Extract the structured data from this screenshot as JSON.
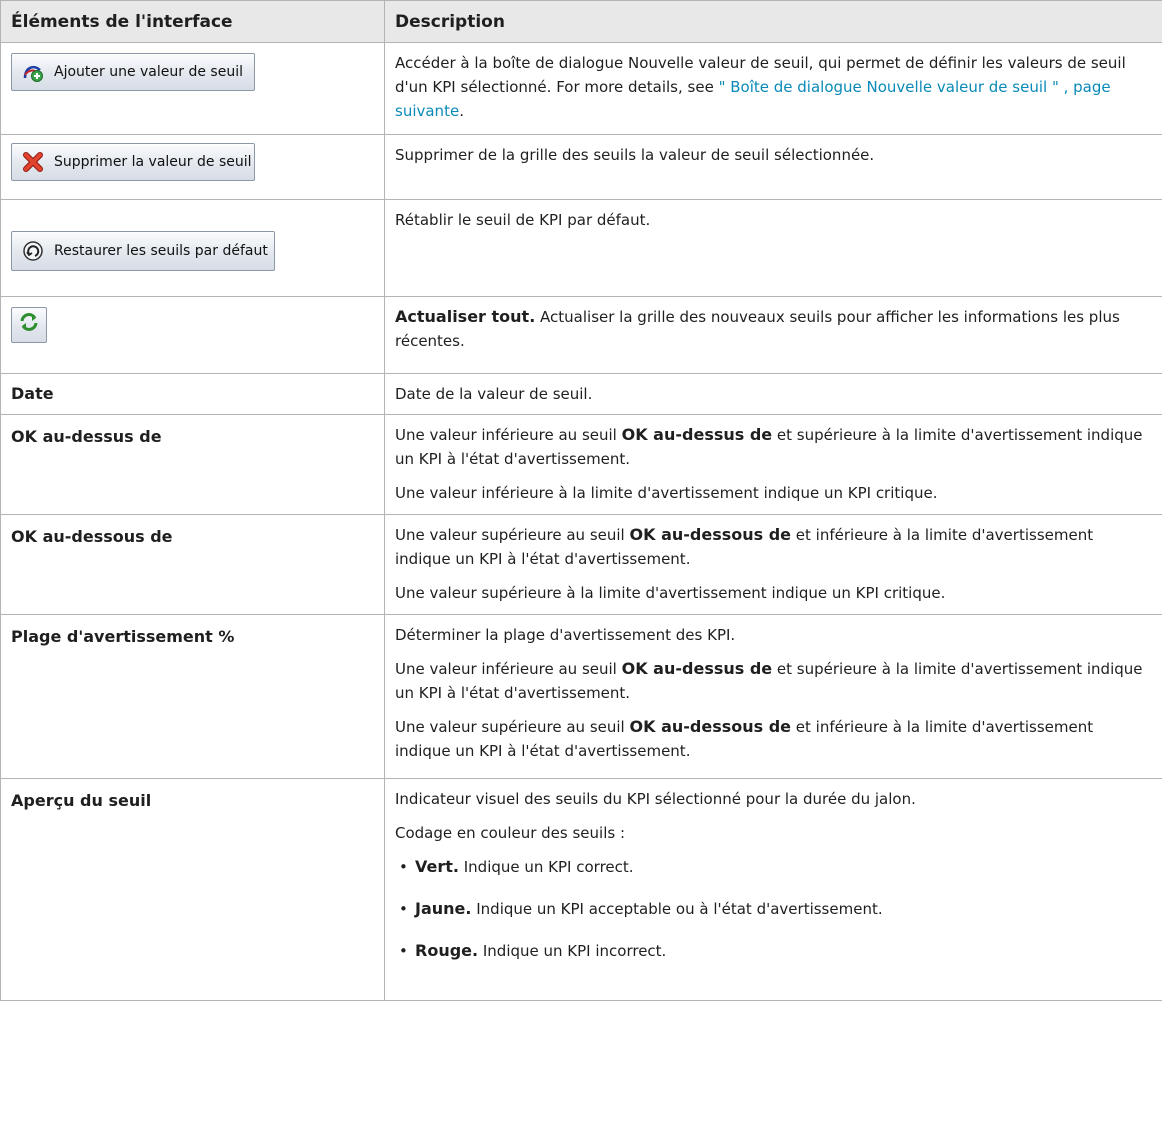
{
  "header": {
    "col1": "Éléments de l'interface",
    "col2": "Description"
  },
  "rows": {
    "add": {
      "button_label": "Ajouter une valeur de seuil",
      "icon": "add-threshold-icon",
      "text": "Accéder à la boîte de dialogue Nouvelle valeur de seuil, qui permet de définir les valeurs de seuil d'un KPI sélectionné. For more details, see ",
      "link": "\" Boîte de dialogue Nouvelle valeur de seuil \" , page suivante",
      "text_end": "."
    },
    "delete": {
      "button_label": "Supprimer la valeur de seuil",
      "icon": "delete-x-icon",
      "text": "Supprimer de la grille des seuils la valeur de seuil sélectionnée."
    },
    "restore": {
      "button_label": "Restaurer les seuils par défaut",
      "icon": "restore-icon",
      "text": "Rétablir le seuil de KPI par défaut."
    },
    "refresh": {
      "icon": "refresh-icon",
      "bold": "Actualiser tout.",
      "text": " Actualiser la grille des nouveaux seuils pour afficher les informations les plus récentes."
    },
    "date": {
      "label": "Date",
      "text": "Date de la valeur de seuil."
    },
    "ok_above": {
      "label": "OK au-dessus de",
      "p1_a": "Une valeur inférieure au seuil ",
      "p1_b": "OK au-dessus de",
      "p1_c": " et supérieure à la limite d'avertissement indique un KPI à l'état d'avertissement.",
      "p2": "Une valeur inférieure à la limite d'avertissement indique un KPI critique."
    },
    "ok_below": {
      "label": "OK au-dessous de",
      "p1_a": "Une valeur supérieure au seuil ",
      "p1_b": "OK au-dessous de",
      "p1_c": " et inférieure à la limite d'avertissement indique un KPI à l'état d'avertissement.",
      "p2": "Une valeur supérieure à la limite d'avertissement indique un KPI critique."
    },
    "warning": {
      "label": "Plage d'avertissement %",
      "p1": "Déterminer la plage d'avertissement des KPI.",
      "p2_a": "Une valeur inférieure au seuil ",
      "p2_b": "OK au-dessus de",
      "p2_c": " et supérieure à la limite d'avertissement indique un KPI à l'état d'avertissement.",
      "p3_a": "Une valeur supérieure au seuil ",
      "p3_b": "OK au-dessous de",
      "p3_c": " et inférieure à la limite d'avertissement indique un KPI à l'état d'avertissement."
    },
    "preview": {
      "label": "Aperçu du seuil",
      "p1": "Indicateur visuel des seuils du KPI sélectionné pour la durée du jalon.",
      "p2": "Codage en couleur des seuils :",
      "bullet_char": "•",
      "items": [
        {
          "bold": "Vert.",
          "text": " Indique un KPI correct."
        },
        {
          "bold": "Jaune.",
          "text": " Indique un KPI acceptable ou à l'état d'avertissement."
        },
        {
          "bold": "Rouge.",
          "text": " Indique un KPI incorrect."
        }
      ]
    }
  }
}
